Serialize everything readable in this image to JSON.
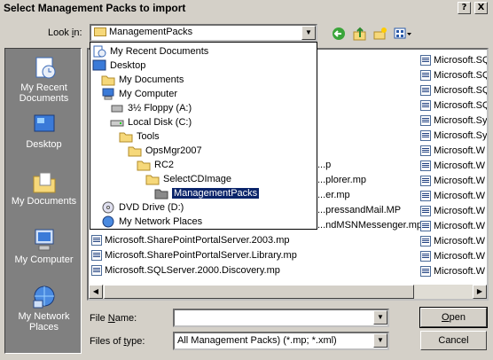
{
  "window": {
    "title": "Select Management Packs to import",
    "help_label": "?",
    "close_label": "X"
  },
  "toolbar": {
    "lookin_prefix": "Look ",
    "lookin_accel": "i",
    "lookin_suffix": "n:",
    "lookin_value": "ManagementPacks",
    "icons": [
      "back-icon",
      "up-folder-icon",
      "new-folder-icon",
      "views-menu-icon"
    ]
  },
  "places": [
    {
      "label": "My Recent Documents",
      "icon": "recent-documents-icon"
    },
    {
      "label": "Desktop",
      "icon": "desktop-icon"
    },
    {
      "label": "My Documents",
      "icon": "my-documents-icon"
    },
    {
      "label": "My Computer",
      "icon": "my-computer-icon"
    },
    {
      "label": "My Network Places",
      "icon": "network-places-icon"
    }
  ],
  "dropdown": [
    {
      "label": "My Recent Documents",
      "icon": "recent-documents-icon"
    },
    {
      "label": "Desktop",
      "icon": "desktop-icon"
    },
    {
      "label": "My Documents",
      "icon": "my-documents-icon"
    },
    {
      "label": "My Computer",
      "icon": "my-computer-icon"
    },
    {
      "label": "3½ Floppy (A:)",
      "icon": "floppy-drive-icon"
    },
    {
      "label": "Local Disk (C:)",
      "icon": "hard-disk-icon"
    },
    {
      "label": "Tools",
      "icon": "folder-icon"
    },
    {
      "label": "OpsMgr2007",
      "icon": "folder-icon"
    },
    {
      "label": "RC2",
      "icon": "folder-icon"
    },
    {
      "label": "SelectCDImage",
      "icon": "folder-icon"
    },
    {
      "label": "ManagementPacks",
      "icon": "open-folder-icon",
      "selected": true
    },
    {
      "label": "DVD Drive (D:)",
      "icon": "dvd-drive-icon"
    },
    {
      "label": "My Network Places",
      "icon": "network-places-icon"
    }
  ],
  "files_col1_visible": [
    {
      "label": "...p",
      "icon": "mp-file-icon"
    },
    {
      "label": "...plorer.mp",
      "icon": "mp-file-icon"
    },
    {
      "label": "...er.mp",
      "icon": "mp-file-icon"
    },
    {
      "label": "...pressandMail.MP",
      "icon": "mp-file-icon"
    },
    {
      "label": "...ndMSNMessenger.mp",
      "icon": "mp-file-icon"
    },
    {
      "label": "Microsoft.SharePointPortalServer.2003.mp",
      "icon": "mp-file-icon"
    },
    {
      "label": "Microsoft.SharePointPortalServer.Library.mp",
      "icon": "mp-file-icon"
    },
    {
      "label": "Microsoft.SQLServer.2000.Discovery.mp",
      "icon": "mp-file-icon"
    }
  ],
  "files_col2": [
    {
      "label": "Microsoft.SQ",
      "icon": "mp-file-icon"
    },
    {
      "label": "Microsoft.SQ",
      "icon": "mp-file-icon"
    },
    {
      "label": "Microsoft.SQ",
      "icon": "mp-file-icon"
    },
    {
      "label": "Microsoft.SQ",
      "icon": "mp-file-icon"
    },
    {
      "label": "Microsoft.Sy",
      "icon": "mp-file-icon"
    },
    {
      "label": "Microsoft.Sy",
      "icon": "mp-file-icon"
    },
    {
      "label": "Microsoft.W",
      "icon": "mp-file-icon"
    },
    {
      "label": "Microsoft.W",
      "icon": "mp-file-icon"
    },
    {
      "label": "Microsoft.W",
      "icon": "mp-file-icon"
    },
    {
      "label": "Microsoft.W",
      "icon": "mp-file-icon"
    },
    {
      "label": "Microsoft.W",
      "icon": "mp-file-icon"
    },
    {
      "label": "Microsoft.W",
      "icon": "mp-file-icon"
    },
    {
      "label": "Microsoft.W",
      "icon": "mp-file-icon"
    },
    {
      "label": "Microsoft.W",
      "icon": "mp-file-icon"
    },
    {
      "label": "Microsoft.W",
      "icon": "mp-file-icon"
    }
  ],
  "file_name": {
    "label_accel": "N",
    "label_prefix": "File ",
    "label_suffix": "ame:",
    "value": ""
  },
  "file_type": {
    "label_prefix": "Files of ",
    "label_accel": "t",
    "label_suffix": "ype:",
    "value": "All Management Packs) (*.mp; *.xml)"
  },
  "buttons": {
    "open_accel": "O",
    "open_rest": "pen",
    "cancel": "Cancel"
  }
}
